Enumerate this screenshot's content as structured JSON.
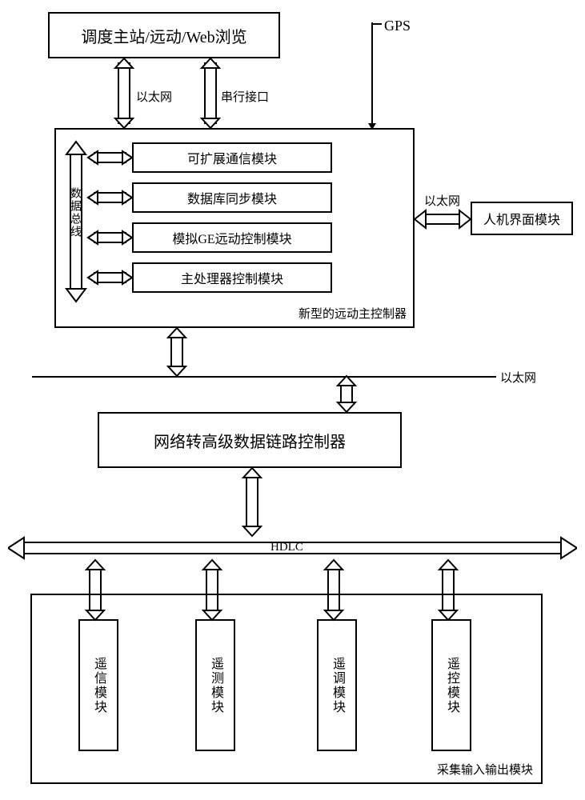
{
  "top": {
    "main_station": "调度主站/远动/Web浏览",
    "gps": "GPS",
    "ethernet_label": "以太网",
    "serial_label": "串行接口"
  },
  "controller": {
    "caption": "新型的远动主控制器",
    "bus_label": "数据总线",
    "modules": [
      "可扩展通信模块",
      "数据库同步模块",
      "模拟GE远动控制模块",
      "主处理器控制模块"
    ],
    "ethernet_label": "以太网"
  },
  "hmi": "人机界面模块",
  "net_to_hdlc": "网络转高级数据链路控制器",
  "ethernet_bus_label": "以太网",
  "hdlc_label": "HDLC",
  "io_block": {
    "caption": "采集输入输出模块",
    "modules": [
      "遥信模块",
      "遥测模块",
      "遥调模块",
      "遥控模块"
    ]
  }
}
